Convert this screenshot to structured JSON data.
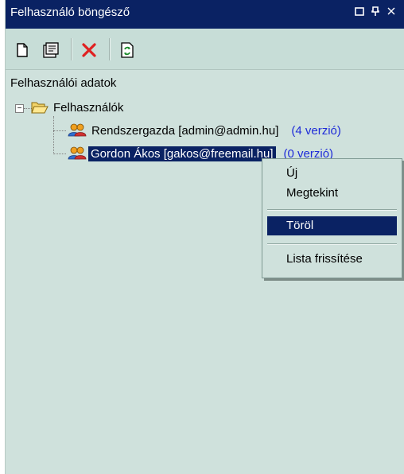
{
  "window": {
    "title": "Felhasználó böngésző",
    "buttons": [
      "□",
      "ꟼ",
      "✕"
    ]
  },
  "toolbar": {
    "icons": [
      "new-document-icon",
      "properties-icon",
      "delete-icon",
      "refresh-icon"
    ]
  },
  "tree": {
    "root_label": "Felhasználói adatok",
    "folder_label": "Felhasználók",
    "expander": "−",
    "users": [
      {
        "name": "Rendszergazda [admin@admin.hu]",
        "versions": "(4 verzió)",
        "selected": false
      },
      {
        "name": "Gordon Ákos [gakos@freemail.hu]",
        "versions": "(0 verzió)",
        "selected": true
      }
    ]
  },
  "context_menu": {
    "items": [
      {
        "label": "Új"
      },
      {
        "label": "Megtekint"
      },
      {
        "label": "Töröl",
        "active": true
      },
      {
        "label": "Lista frissítése"
      }
    ]
  },
  "colors": {
    "accent": "#0a2263",
    "panel": "#cfe1dc",
    "link": "#1e2bd8",
    "delete": "#e02020"
  }
}
